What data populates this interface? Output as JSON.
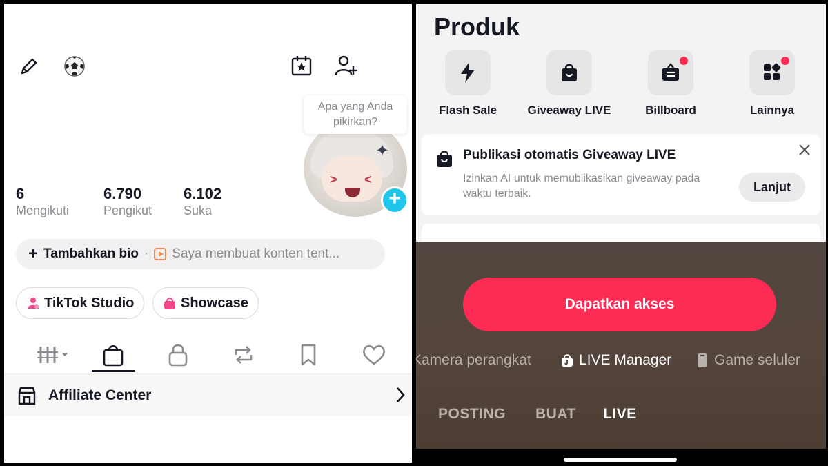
{
  "left": {
    "speech_bubble": "Apa yang Anda pikirkan?",
    "stats": [
      {
        "value": "6",
        "label": "Mengikuti"
      },
      {
        "value": "6.790",
        "label": "Pengikut"
      },
      {
        "value": "6.102",
        "label": "Suka"
      }
    ],
    "bio": {
      "add_label": "Tambahkan bio",
      "separator": "·",
      "description": "Saya membuat konten tent..."
    },
    "pills": [
      {
        "label": "TikTok Studio",
        "icon": "person-icon"
      },
      {
        "label": "Showcase",
        "icon": "shopping-bag-icon"
      }
    ],
    "tabs": [
      "grid-icon",
      "shopping-bag-icon",
      "lock-icon",
      "repost-icon",
      "bookmark-icon",
      "heart-icon"
    ],
    "affiliate_label": "Affiliate Center"
  },
  "right": {
    "heading": "Produk",
    "products": [
      {
        "label": "Flash Sale",
        "icon": "lightning-icon",
        "dot": false
      },
      {
        "label": "Giveaway LIVE",
        "icon": "gift-bag-icon",
        "dot": false
      },
      {
        "label": "Billboard",
        "icon": "billboard-icon",
        "dot": true
      },
      {
        "label": "Lainnya",
        "icon": "apps-icon",
        "dot": true
      }
    ],
    "card": {
      "title": "Publikasi otomatis Giveaway LIVE",
      "text": "Izinkan AI untuk memublikasikan giveaway pada waktu terbaik.",
      "button": "Lanjut"
    },
    "cta": "Dapatkan akses",
    "modes": [
      "Kamera perangkat",
      "LIVE Manager",
      "Game seluler"
    ],
    "bottom_tabs": [
      "POSTING",
      "BUAT",
      "LIVE"
    ],
    "colors": {
      "accent": "#fe2c55",
      "badge": "#20c5ec"
    }
  }
}
